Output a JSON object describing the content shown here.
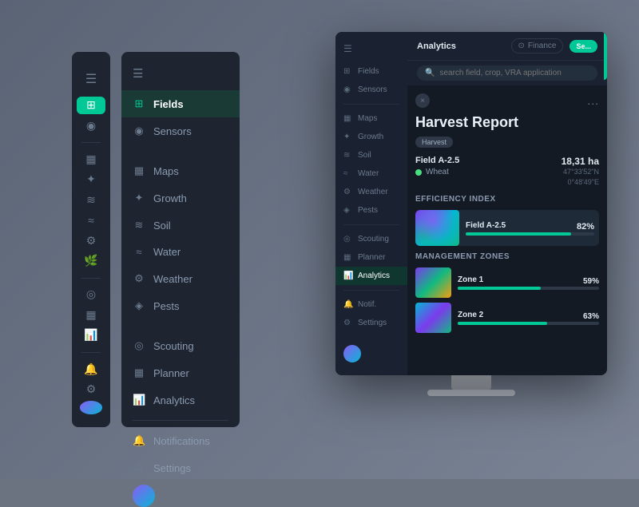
{
  "background": {
    "color": "#6b7280"
  },
  "collapsed_sidebar": {
    "items": [
      {
        "icon": "☰",
        "name": "menu",
        "active": false
      },
      {
        "icon": "⊞",
        "name": "fields",
        "active": true
      },
      {
        "icon": "◎",
        "name": "sensors",
        "active": false
      },
      {
        "icon": "▦",
        "name": "maps",
        "active": false
      },
      {
        "icon": "✦",
        "name": "growth",
        "active": false
      },
      {
        "icon": "≋",
        "name": "soil",
        "active": false
      },
      {
        "icon": "≈",
        "name": "water",
        "active": false
      },
      {
        "icon": "⚙",
        "name": "weather",
        "active": false
      },
      {
        "icon": "🌿",
        "name": "pests",
        "active": false
      },
      {
        "icon": "◎",
        "name": "scouting",
        "active": false
      },
      {
        "icon": "▦",
        "name": "planner",
        "active": false
      },
      {
        "icon": "📊",
        "name": "analytics",
        "active": false
      },
      {
        "icon": "🔔",
        "name": "notifications",
        "active": false
      },
      {
        "icon": "⚙",
        "name": "settings",
        "active": false
      }
    ]
  },
  "expanded_sidebar": {
    "menu_icon": "☰",
    "items": [
      {
        "icon": "⊞",
        "label": "Fields",
        "active": true
      },
      {
        "icon": "◎",
        "label": "Sensors",
        "active": false
      },
      {
        "icon": "▦",
        "label": "Maps",
        "active": false
      },
      {
        "icon": "✦",
        "label": "Growth",
        "active": false
      },
      {
        "icon": "≋",
        "label": "Soil",
        "active": false
      },
      {
        "icon": "≈",
        "label": "Water",
        "active": false
      },
      {
        "icon": "⚙",
        "label": "Weather",
        "active": false
      },
      {
        "icon": "🌿",
        "label": "Pests",
        "active": false
      },
      {
        "icon": "◎",
        "label": "Scouting",
        "active": false
      },
      {
        "icon": "▦",
        "label": "Planner",
        "active": false
      },
      {
        "icon": "📊",
        "label": "Analytics",
        "active": false
      },
      {
        "icon": "🔔",
        "label": "Notifications",
        "active": false
      },
      {
        "icon": "⚙",
        "label": "Settings",
        "active": false
      }
    ]
  },
  "app": {
    "header": {
      "title": "Analytics",
      "finance_label": "Finance",
      "cta_label": "Se..."
    },
    "search": {
      "placeholder": "search field, crop, VRA application"
    },
    "sidebar": {
      "items": [
        {
          "icon": "⊞",
          "label": "Fields",
          "active": false
        },
        {
          "icon": "◎",
          "label": "Sensors",
          "active": false
        },
        {
          "icon": "▦",
          "label": "Maps",
          "active": false
        },
        {
          "icon": "✦",
          "label": "Growth",
          "active": false
        },
        {
          "icon": "≋",
          "label": "Soil",
          "active": false
        },
        {
          "icon": "≈",
          "label": "Water",
          "active": false
        },
        {
          "icon": "⚙",
          "label": "Weather",
          "active": false
        },
        {
          "icon": "🌿",
          "label": "Pests",
          "active": false
        },
        {
          "icon": "◎",
          "label": "Scouting",
          "active": false
        },
        {
          "icon": "▦",
          "label": "Planner",
          "active": false
        },
        {
          "icon": "📊",
          "label": "Analytics",
          "active": true
        },
        {
          "icon": "🔔",
          "label": "Notifications",
          "active": false
        },
        {
          "icon": "⚙",
          "label": "Settings",
          "active": false
        }
      ]
    },
    "report": {
      "title": "Harvest Report",
      "badge": "Harvest",
      "close_icon": "×",
      "dots": "...",
      "field_name": "Field A-2.5",
      "crop": "Wheat",
      "hectares": "18,31 ha",
      "coords_line1": "47°33'52\"N",
      "coords_line2": "0°48'49\"E",
      "efficiency_title": "Efficiency Index",
      "efficiency_items": [
        {
          "field": "Field A-2.5",
          "pct": 82,
          "pct_label": "82%"
        }
      ],
      "zones_title": "Management Zones",
      "zones": [
        {
          "name": "Zone 1",
          "pct": 59,
          "pct_label": "59%"
        },
        {
          "name": "Zone 2",
          "pct": 63,
          "pct_label": "63%"
        }
      ]
    }
  }
}
